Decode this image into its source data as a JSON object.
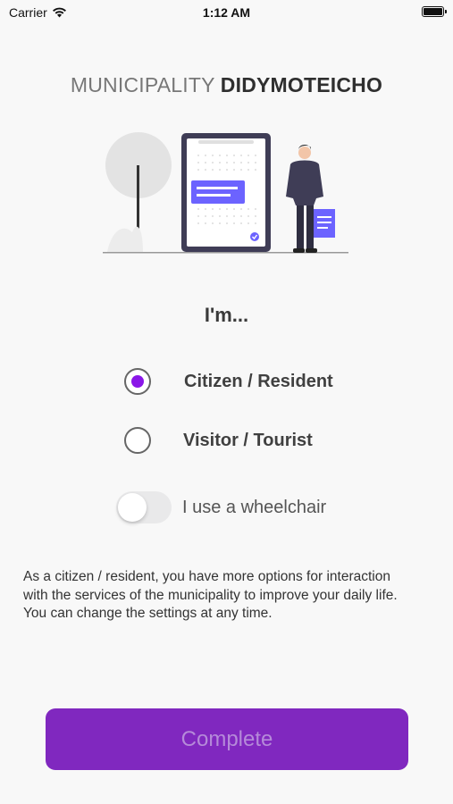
{
  "status_bar": {
    "carrier": "Carrier",
    "time": "1:12 AM",
    "battery_level": 100
  },
  "header": {
    "title_light": "MUNICIPALITY",
    "title_bold": "DIDYMOTEICHO"
  },
  "illustration": {
    "name": "person-with-document-illustration",
    "accent_color": "#6c63ff"
  },
  "role": {
    "label": "I'm...",
    "options": [
      {
        "label": "Citizen / Resident",
        "selected": true
      },
      {
        "label": "Visitor / Tourist",
        "selected": false
      }
    ],
    "accent_color": "#8a17e8"
  },
  "wheelchair": {
    "label": "I use a wheelchair",
    "enabled": false
  },
  "description": "As a citizen / resident, you have more options for interaction with the services of the municipality to improve your daily life. You can change the settings at any time.",
  "complete_button": {
    "label": "Complete",
    "color": "#8028bf"
  }
}
